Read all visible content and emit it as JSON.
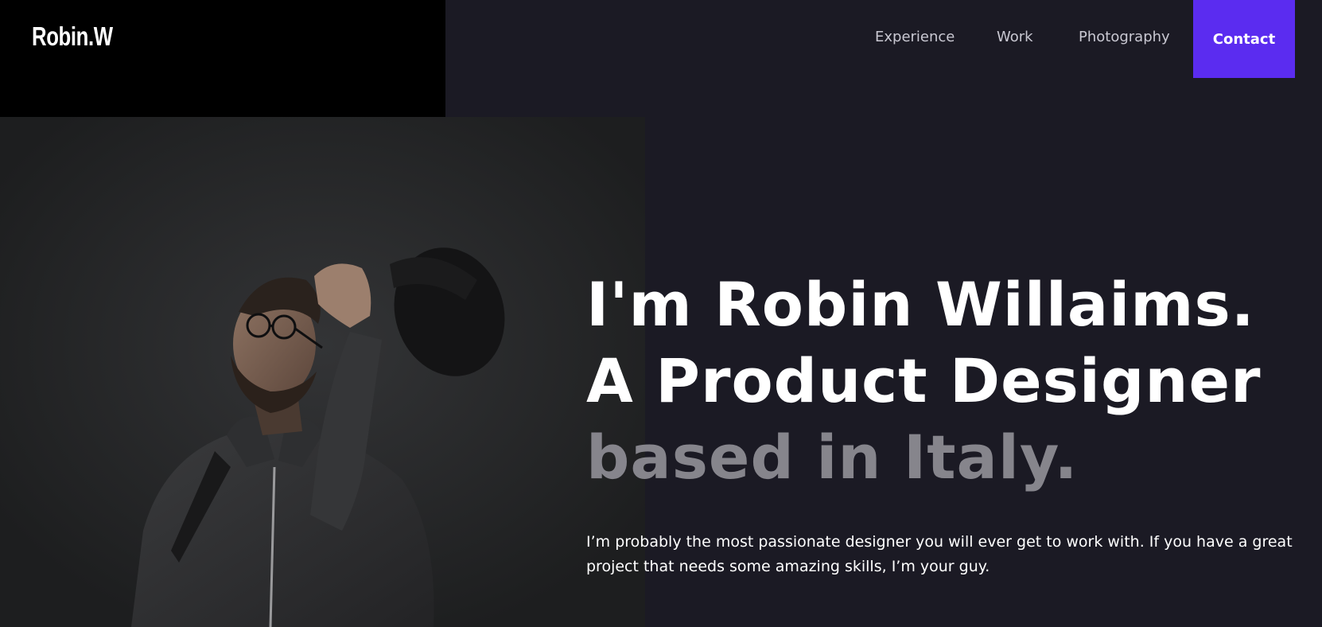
{
  "brand": {
    "logo": "Robin.W"
  },
  "nav": {
    "items": [
      {
        "label": "Experience"
      },
      {
        "label": "Work"
      },
      {
        "label": "Photography"
      }
    ],
    "contact_label": "Contact"
  },
  "hero": {
    "line1": "I'm Robin Willaims.",
    "line2": "A Product Designer",
    "line3": "based in Italy.",
    "intro": "I’m probably the most passionate designer you will ever get to work with. If you have a great project that needs some amazing skills, I’m your guy."
  },
  "colors": {
    "background": "#1b1a24",
    "logo_block": "#000000",
    "accent": "#5b2cf0",
    "muted_heading": "#86858c"
  }
}
